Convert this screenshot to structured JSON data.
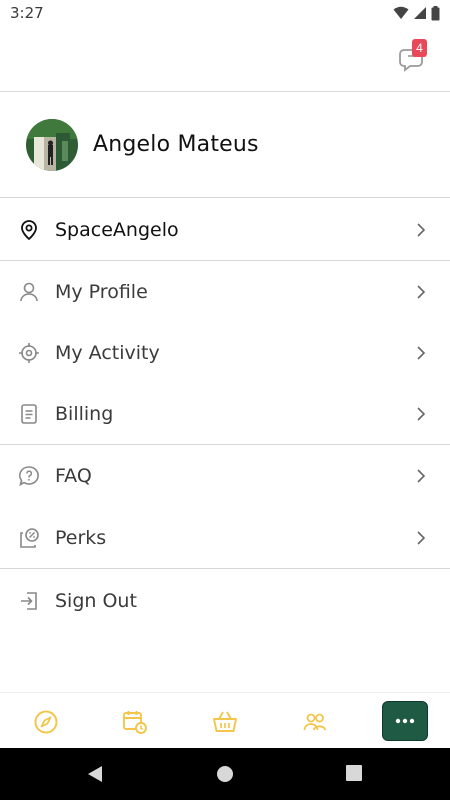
{
  "status": {
    "time": "3:27"
  },
  "notifications": {
    "count": "4"
  },
  "profile": {
    "name": "Angelo Mateus"
  },
  "menu": {
    "space": "SpaceAngelo",
    "my_profile": "My Profile",
    "my_activity": "My Activity",
    "billing": "Billing",
    "faq": "FAQ",
    "perks": "Perks",
    "sign_out": "Sign Out"
  },
  "colors": {
    "accent_yellow": "#f3c64b",
    "more_button": "#1e5a44",
    "badge": "#e8495a"
  },
  "bottom_nav": {
    "items": [
      "explore-icon",
      "calendar-icon",
      "basket-icon",
      "people-icon",
      "more-icon"
    ]
  }
}
